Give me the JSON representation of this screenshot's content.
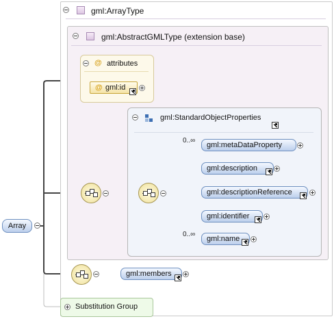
{
  "root": {
    "label": "Array"
  },
  "array_type": {
    "label": "gml:ArrayType"
  },
  "abstract_gml_type": {
    "label": "gml:AbstractGMLType (extension base)"
  },
  "attributes": {
    "label": "attributes",
    "items": [
      {
        "label": "gml:id"
      }
    ]
  },
  "standard_object_properties": {
    "label": "gml:StandardObjectProperties",
    "elements": [
      {
        "label": "gml:metaDataProperty",
        "occurrence": "0..∞"
      },
      {
        "label": "gml:description",
        "occurrence": ""
      },
      {
        "label": "gml:descriptionReference",
        "occurrence": ""
      },
      {
        "label": "gml:identifier",
        "occurrence": ""
      },
      {
        "label": "gml:name",
        "occurrence": "0..∞"
      }
    ]
  },
  "members": {
    "label": "gml:members"
  },
  "substitution_group": {
    "label": "Substitution Group"
  },
  "colors": {
    "element_border": "#6d8fbf",
    "attribute_border": "#c7a53a",
    "compositor_fill": "#efe09a",
    "abstract_bg": "#f6f0f6",
    "sequence_bg": "#f1f4fa"
  }
}
